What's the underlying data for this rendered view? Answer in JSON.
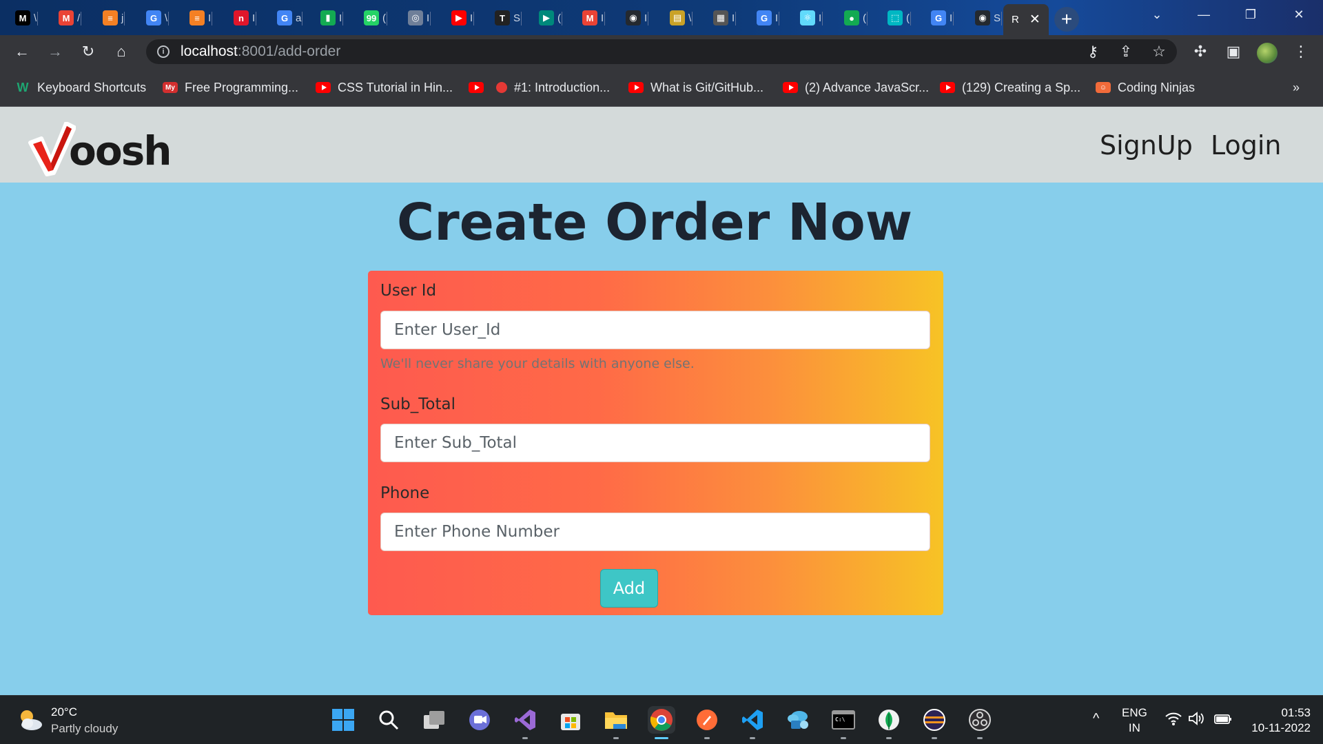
{
  "browser": {
    "tabs": [
      {
        "icon": "medium-icon",
        "glyph": "M",
        "color": "#000000",
        "text": "\\"
      },
      {
        "icon": "gmail-icon",
        "glyph": "M",
        "color": "#ea4335",
        "text": "/"
      },
      {
        "icon": "stackoverflow-icon",
        "glyph": "≡",
        "color": "#f48024",
        "text": "j"
      },
      {
        "icon": "google-icon",
        "glyph": "G",
        "color": "#4285f4",
        "text": "\\"
      },
      {
        "icon": "stackoverflow-icon",
        "glyph": "≡",
        "color": "#f48024",
        "text": "I"
      },
      {
        "icon": "notion-red-icon",
        "glyph": "n",
        "color": "#e0162b",
        "text": "I"
      },
      {
        "icon": "google-icon",
        "glyph": "G",
        "color": "#4285f4",
        "text": "a"
      },
      {
        "icon": "mongodb-doc-icon",
        "glyph": "▮",
        "color": "#13aa52",
        "text": "I"
      },
      {
        "icon": "whatsapp-icon",
        "glyph": "99",
        "color": "#25d366",
        "text": "("
      },
      {
        "icon": "globe-icon",
        "glyph": "◎",
        "color": "#6f7f99",
        "text": "I"
      },
      {
        "icon": "youtube-icon",
        "glyph": "▶",
        "color": "#ff0000",
        "text": "I"
      },
      {
        "icon": "t-logo-icon",
        "glyph": "T",
        "color": "#222222",
        "text": "S"
      },
      {
        "icon": "google-meet-icon",
        "glyph": "▶",
        "color": "#00897b",
        "text": "("
      },
      {
        "icon": "gmail-icon",
        "glyph": "M",
        "color": "#ea4335",
        "text": "I"
      },
      {
        "icon": "github-icon",
        "glyph": "◉",
        "color": "#24292f",
        "text": "I"
      },
      {
        "icon": "notes-icon",
        "glyph": "▤",
        "color": "#c9a227",
        "text": "\\"
      },
      {
        "icon": "document-icon",
        "glyph": "▦",
        "color": "#555555",
        "text": "I"
      },
      {
        "icon": "google-icon",
        "glyph": "G",
        "color": "#4285f4",
        "text": "I"
      },
      {
        "icon": "react-icon",
        "glyph": "⚛",
        "color": "#61dafb",
        "text": "I"
      },
      {
        "icon": "mongodb-leaf-icon",
        "glyph": "●",
        "color": "#13aa52",
        "text": "("
      },
      {
        "icon": "screenshot-icon",
        "glyph": "⬚",
        "color": "#00b7c3",
        "text": "("
      },
      {
        "icon": "google-icon",
        "glyph": "G",
        "color": "#4285f4",
        "text": "I"
      },
      {
        "icon": "github-icon",
        "glyph": "◉",
        "color": "#24292f",
        "text": "S"
      }
    ],
    "active_tab": {
      "text": "R",
      "close": "✕"
    },
    "new_tab": "+",
    "window_controls": {
      "list": "⌄",
      "minimize": "—",
      "restore": "❐",
      "close": "✕"
    },
    "toolbar": {
      "back": "←",
      "forward": "→",
      "reload": "↻",
      "home": "⌂",
      "key": "⚷",
      "share": "⇪",
      "star": "☆",
      "extensions": "✣",
      "sidepanel": "▣",
      "menu": "⋮"
    },
    "url": {
      "info": "i",
      "host": "localhost",
      "path": ":8001/add-order"
    },
    "bookmarks": [
      {
        "icon": "wordpress-icon",
        "label": "Keyboard Shortcuts",
        "color": "#1ea672",
        "glyph": "W"
      },
      {
        "icon": "mycompiler-icon",
        "label": "Free Programming...",
        "color": "#d32f2f",
        "glyph": "My"
      },
      {
        "icon": "youtube-icon",
        "label": "CSS Tutorial in Hin...",
        "color": "#ff0000",
        "glyph": ""
      },
      {
        "icon": "youtube-icon",
        "label": "",
        "color": "#ff0000",
        "glyph": ""
      },
      {
        "icon": "red-dot-icon",
        "label": "#1: Introduction...",
        "color": "#e53935",
        "glyph": ""
      },
      {
        "icon": "youtube-icon",
        "label": "What is Git/GitHub...",
        "color": "#ff0000",
        "glyph": ""
      },
      {
        "icon": "youtube-icon",
        "label": "(2) Advance JavaScr...",
        "color": "#ff0000",
        "glyph": ""
      },
      {
        "icon": "youtube-icon",
        "label": "(129) Creating a Sp...",
        "color": "#ff0000",
        "glyph": ""
      },
      {
        "icon": "coding-ninjas-icon",
        "label": "Coding Ninjas",
        "color": "#f26b3a",
        "glyph": "☺"
      }
    ],
    "bookmarks_more": "»"
  },
  "page": {
    "logo_text": "oosh",
    "nav": {
      "signup": "SignUp",
      "login": "Login"
    },
    "title": "Create Order Now",
    "form": {
      "user_id_label": "User Id",
      "user_id_placeholder": "Enter User_Id",
      "user_id_help": "We'll never share your details with anyone else.",
      "sub_total_label": "Sub_Total",
      "sub_total_placeholder": "Enter Sub_Total",
      "phone_label": "Phone",
      "phone_placeholder": "Enter Phone Number",
      "submit": "Add"
    },
    "colors": {
      "page_bg": "#87ceeb",
      "navbar_bg": "#d4dada",
      "card_start": "#fe5a4f",
      "card_end": "#f7c325",
      "button": "#3ec6c6"
    }
  },
  "taskbar": {
    "weather": {
      "temp": "20°C",
      "desc": "Partly cloudy"
    },
    "apps": [
      {
        "name": "start",
        "icon": "windows-start-icon"
      },
      {
        "name": "search",
        "icon": "search-icon"
      },
      {
        "name": "task-view",
        "icon": "task-view-icon"
      },
      {
        "name": "chat",
        "icon": "teams-chat-icon"
      },
      {
        "name": "visual-studio",
        "icon": "visual-studio-icon"
      },
      {
        "name": "store",
        "icon": "microsoft-store-icon"
      },
      {
        "name": "file-explorer",
        "icon": "folder-icon"
      },
      {
        "name": "chrome",
        "icon": "chrome-icon"
      },
      {
        "name": "postman",
        "icon": "postman-icon"
      },
      {
        "name": "vscode",
        "icon": "vscode-icon"
      },
      {
        "name": "azure-data-studio",
        "icon": "cloud-db-icon"
      },
      {
        "name": "terminal",
        "icon": "terminal-icon"
      },
      {
        "name": "mongodb-compass",
        "icon": "mongodb-leaf-icon"
      },
      {
        "name": "eclipse",
        "icon": "eclipse-icon"
      },
      {
        "name": "obs",
        "icon": "obs-icon"
      }
    ],
    "tray": {
      "overflow": "^",
      "lang": "ENG",
      "region": "IN",
      "time": "01:53",
      "date": "10-11-2022"
    }
  }
}
